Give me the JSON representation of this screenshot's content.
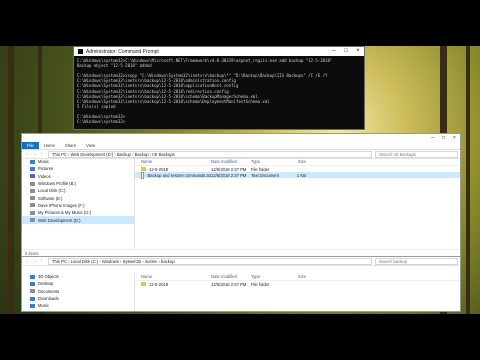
{
  "cmd": {
    "title": "Administrator: Command Prompt",
    "lines": [
      "C:\\Windows\\system32>C:\\Windows\\Microsoft.NET\\Framework\\v4.0.30319\\aspnet_regiis.exe add backup \"12-5-2018\"",
      "Backup object \"12-5-2018\" added",
      "",
      "C:\\Windows\\system32>xcopy \"C:\\Windows\\System32\\inetsrv\\backup\\*\" \"D:\\Backup\\Backup\\IIS Backups\" /I /E /Y",
      "C:\\Windows\\System32\\inetsrv\\backup\\12-5-2018\\administration.config",
      "C:\\Windows\\System32\\inetsrv\\backup\\12-5-2018\\applicationHost.config",
      "C:\\Windows\\System32\\inetsrv\\backup\\12-5-2018\\redirection.config",
      "C:\\Windows\\System32\\inetsrv\\backup\\12-5-2018\\schema\\BackupManagerSchema.xml",
      "C:\\Windows\\System32\\inetsrv\\backup\\12-5-2018\\schema\\DeploymentManifestSchema.xml",
      "5 File(s) copied",
      "",
      "C:\\Windows\\system32>",
      "C:\\Windows\\system32>"
    ]
  },
  "explorer1": {
    "ribbon": {
      "file": "File",
      "tabs": [
        "Home",
        "Share",
        "View"
      ]
    },
    "path": [
      "This PC",
      "Web Development (D:)",
      "Backup",
      "Backup",
      "IIS Backups"
    ],
    "search": "Search IIS Backups",
    "columns": {
      "name": "Name",
      "date": "Date modified",
      "type": "Type",
      "size": "Size"
    },
    "nav_items": [
      {
        "label": "Music",
        "color": "#3a7bd5"
      },
      {
        "label": "Pictures",
        "color": "#3a7bd5"
      },
      {
        "label": "Videos",
        "color": "#7a4fc9"
      },
      {
        "label": "Windows Profile (B:)",
        "color": "#8e8e8e"
      },
      {
        "label": "Local Disk (C:)",
        "color": "#8e8e8e"
      },
      {
        "label": "Software (E:)",
        "color": "#8e8e8e"
      },
      {
        "label": "Dave iPhone Images (F:)",
        "color": "#8e8e8e"
      },
      {
        "label": "My Pictures & My Music (G:)",
        "color": "#8e8e8e"
      },
      {
        "label": "Web Development (D:)",
        "color": "#8e8e8e",
        "selected": true
      }
    ],
    "files": [
      {
        "name": "12-5-2018",
        "date": "12/5/2018 2:37 PM",
        "type": "File folder",
        "size": "",
        "kind": "folder"
      },
      {
        "name": "Backup and restore commands.txt",
        "date": "12/5/2018 2:37 PM",
        "type": "Text Document",
        "size": "1 KB",
        "kind": "file",
        "selected": true
      }
    ],
    "status": "2 items"
  },
  "explorer2": {
    "path": [
      "This PC",
      "Local Disk (C:)",
      "Windows",
      "System32",
      "inetsrv",
      "backup"
    ],
    "search": "Search backup",
    "columns": {
      "name": "Name",
      "date": "Date modified",
      "type": "Type",
      "size": "Size"
    },
    "nav_items": [
      {
        "label": "3D Objects",
        "color": "#3a7bd5"
      },
      {
        "label": "Desktop",
        "color": "#3a7bd5"
      },
      {
        "label": "Documents",
        "color": "#8e8e8e"
      },
      {
        "label": "Downloads",
        "color": "#3a7bd5"
      },
      {
        "label": "Music",
        "color": "#3a7bd5"
      },
      {
        "label": "Pictures",
        "color": "#3a7bd5"
      },
      {
        "label": "Videos",
        "color": "#7a4fc9"
      },
      {
        "label": "Windows Profile (B:)",
        "color": "#8e8e8e"
      },
      {
        "label": "Local Disk (C:)",
        "color": "#8e8e8e",
        "selected": true
      }
    ],
    "files": [
      {
        "name": "12-5-2018",
        "date": "12/5/2018 2:37 PM",
        "type": "File folder",
        "size": "",
        "kind": "folder"
      }
    ]
  }
}
